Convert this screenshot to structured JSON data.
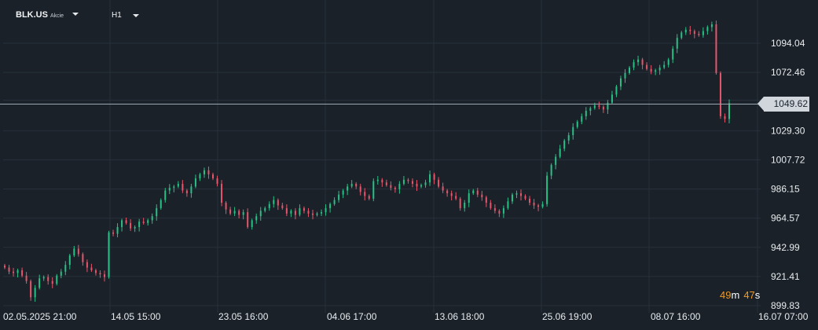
{
  "toolbar": {
    "symbol": "BLK.US",
    "instrument_type": "Akcie",
    "timeframe": "H1"
  },
  "last_price": "1049.62",
  "countdown": {
    "minutes": "49",
    "minutes_unit": "m",
    "seconds": "47",
    "seconds_unit": "s"
  },
  "colors": {
    "background": "#1a2128",
    "grid": "#27303a",
    "up": "#2bbf86",
    "down": "#e4566b",
    "price_line": "#9aa6b0",
    "axis_text": "#e8ecef"
  },
  "chart_data": {
    "type": "candlestick",
    "timeframe": "H1",
    "y_ticks": [
      "1094.04",
      "1072.46",
      "1049.62",
      "1029.30",
      "1007.72",
      "986.15",
      "964.57",
      "942.99",
      "921.41",
      "899.83"
    ],
    "y_tick_values": [
      1094.04,
      1072.46,
      1051.87,
      1029.3,
      1007.72,
      986.15,
      964.57,
      942.99,
      921.41,
      899.83
    ],
    "ylim": [
      894,
      1115
    ],
    "x_ticks": [
      "02.05.2025  21:00",
      "14.05  15:00",
      "23.05  16:00",
      "04.06  17:00",
      "13.06  18:00",
      "25.06  19:00",
      "08.07  16:00",
      "16.07  07:00"
    ],
    "current_price": 1049.62,
    "grid": true,
    "series_closes": [
      928,
      925,
      924,
      926,
      922,
      918,
      906,
      913,
      920,
      921,
      918,
      916,
      922,
      925,
      930,
      937,
      942,
      938,
      932,
      928,
      926,
      924,
      923,
      921,
      954,
      953,
      958,
      963,
      961,
      957,
      958,
      962,
      961,
      963,
      966,
      972,
      978,
      985,
      987,
      988,
      990,
      985,
      983,
      988,
      994,
      997,
      1000,
      997,
      994,
      990,
      976,
      971,
      968,
      970,
      967,
      969,
      958,
      963,
      966,
      970,
      972,
      975,
      978,
      974,
      972,
      968,
      970,
      967,
      972,
      970,
      968,
      967,
      968,
      969,
      972,
      975,
      978,
      982,
      985,
      988,
      990,
      988,
      984,
      981,
      979,
      992,
      993,
      991,
      989,
      987,
      986,
      990,
      993,
      992,
      990,
      988,
      989,
      991,
      997,
      993,
      988,
      985,
      983,
      981,
      979,
      972,
      976,
      983,
      985,
      982,
      980,
      976,
      972,
      970,
      968,
      972,
      977,
      982,
      983,
      981,
      979,
      976,
      974,
      973,
      975,
      996,
      1004,
      1010,
      1016,
      1022,
      1026,
      1032,
      1036,
      1040,
      1044,
      1046,
      1048,
      1047,
      1045,
      1050,
      1056,
      1062,
      1068,
      1072,
      1076,
      1080,
      1082,
      1078,
      1075,
      1073,
      1074,
      1076,
      1078,
      1082,
      1090,
      1098,
      1102,
      1104,
      1103,
      1101,
      1100,
      1103,
      1106,
      1108,
      1072,
      1040,
      1038,
      1049.62
    ]
  }
}
